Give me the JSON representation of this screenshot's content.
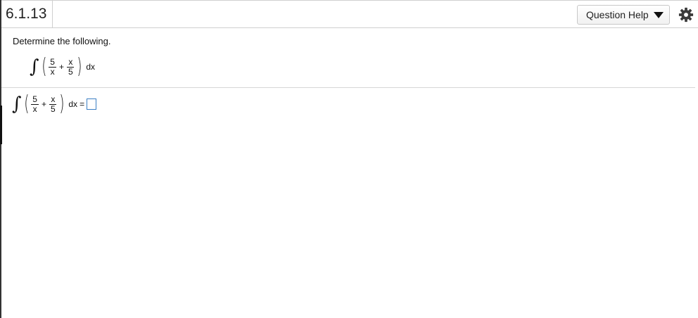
{
  "header": {
    "question_number": "6.1.13",
    "help_button_label": "Question Help",
    "help_caret_icon": "caret-down-icon",
    "settings_icon": "gear-icon"
  },
  "problem": {
    "prompt": "Determine the following.",
    "integral_symbol": "∫",
    "frac1_num": "5",
    "frac1_den": "x",
    "plus": "+",
    "frac2_num": "x",
    "frac2_den": "5",
    "dx": "dx"
  },
  "answer": {
    "integral_symbol": "∫",
    "frac1_num": "5",
    "frac1_den": "x",
    "plus": "+",
    "frac2_num": "x",
    "frac2_den": "5",
    "dx": "dx",
    "equals": "=",
    "input_value": ""
  },
  "colors": {
    "answer_box_border": "#3b7fc4",
    "header_border": "#cfcfcf"
  }
}
